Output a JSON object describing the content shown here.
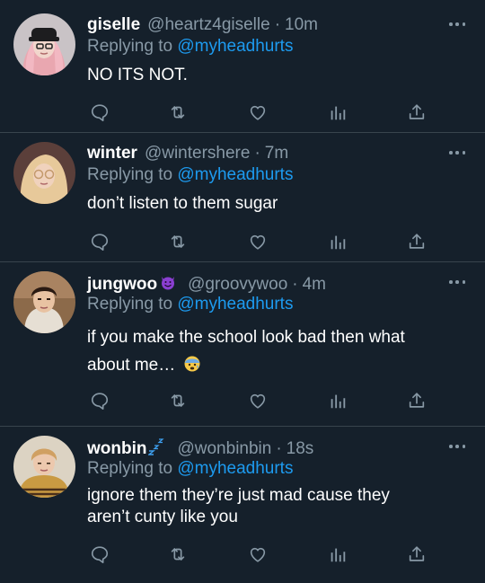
{
  "colors": {
    "background": "#15202b",
    "divider": "#38444d",
    "muted": "#8899a6",
    "accent": "#1d9bf0",
    "text": "#ffffff"
  },
  "tweets": [
    {
      "display_name": "giselle",
      "handle": "@heartz4giselle",
      "separator": "·",
      "time": "10m",
      "reply_prefix": "Replying to",
      "reply_to": "@myheadhurts",
      "body": "NO ITS NOT.",
      "badge_icon": ""
    },
    {
      "display_name": "winter",
      "handle": "@wintershere",
      "separator": "·",
      "time": "7m",
      "reply_prefix": "Replying to",
      "reply_to": "@myheadhurts",
      "body": "don’t listen to them sugar",
      "badge_icon": ""
    },
    {
      "display_name": "jungwoo",
      "handle": "@groovywoo",
      "separator": "·",
      "time": "4m",
      "reply_prefix": "Replying to",
      "reply_to": "@myheadhurts",
      "body": "if you make the school look bad then what about me…",
      "badge_icon": "smiling-devil-icon"
    },
    {
      "display_name": "wonbin",
      "handle": "@wonbinbin",
      "separator": "·",
      "time": "18s",
      "reply_prefix": "Replying to",
      "reply_to": "@myheadhurts",
      "body": "ignore them they’re just mad cause they aren’t cunty like you",
      "badge_icon": "zzz-icon"
    }
  ],
  "action_icons": [
    "reply-icon",
    "retweet-icon",
    "like-icon",
    "analytics-icon",
    "share-icon"
  ],
  "more_icon": "more-options-icon"
}
